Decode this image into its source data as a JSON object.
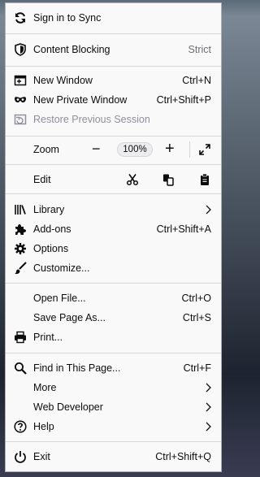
{
  "menu": {
    "sign_in": "Sign in to Sync",
    "content_blocking": {
      "label": "Content Blocking",
      "value": "Strict"
    },
    "new_window": {
      "label": "New Window",
      "shortcut": "Ctrl+N"
    },
    "new_private_window": {
      "label": "New Private Window",
      "shortcut": "Ctrl+Shift+P"
    },
    "restore_session": "Restore Previous Session",
    "zoom": {
      "label": "Zoom",
      "minus": "−",
      "value": "100%",
      "plus": "+"
    },
    "edit": {
      "label": "Edit"
    },
    "library": "Library",
    "addons": {
      "label": "Add-ons",
      "shortcut": "Ctrl+Shift+A"
    },
    "options": "Options",
    "customize": "Customize...",
    "open_file": {
      "label": "Open File...",
      "shortcut": "Ctrl+O"
    },
    "save_page": {
      "label": "Save Page As...",
      "shortcut": "Ctrl+S"
    },
    "print": "Print...",
    "find": {
      "label": "Find in This Page...",
      "shortcut": "Ctrl+F"
    },
    "more": "More",
    "web_developer": "Web Developer",
    "help": "Help",
    "exit": {
      "label": "Exit",
      "shortcut": "Ctrl+Shift+Q"
    }
  }
}
